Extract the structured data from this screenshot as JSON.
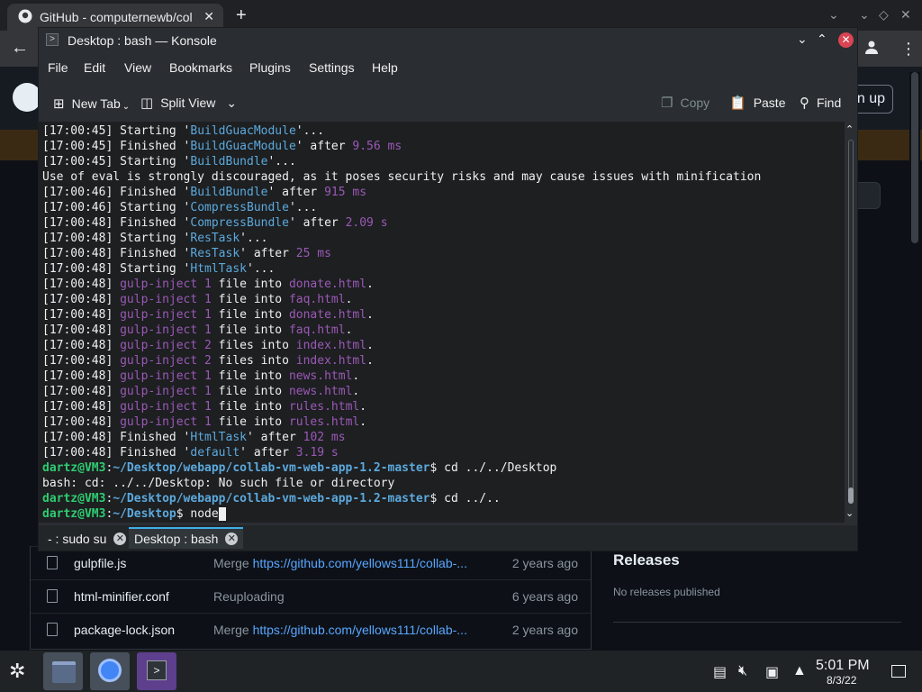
{
  "browser": {
    "tab_title": "GitHub - computernewb/collab",
    "close": "✕",
    "new_tab": "+",
    "signup_label": "n up"
  },
  "github": {
    "files": [
      {
        "name": "gulpfile.js",
        "msg_prefix": "Merge ",
        "msg_link": "https://github.com/yellows111/collab-...",
        "age": "2 years ago"
      },
      {
        "name": "html-minifier.conf",
        "msg_prefix": "Reuploading",
        "msg_link": "",
        "age": "6 years ago"
      },
      {
        "name": "package-lock.json",
        "msg_prefix": "Merge ",
        "msg_link": "https://github.com/yellows111/collab-...",
        "age": "2 years ago"
      }
    ],
    "releases_title": "Releases",
    "releases_sub": "No releases published"
  },
  "konsole": {
    "title": "Desktop : bash — Konsole",
    "menu": [
      "File",
      "Edit",
      "View",
      "Bookmarks",
      "Plugins",
      "Settings",
      "Help"
    ],
    "toolbar": {
      "new_tab": "New Tab",
      "split_view": "Split View",
      "copy": "Copy",
      "paste": "Paste",
      "find": "Find"
    },
    "lines": [
      [
        [
          "17:00:45",
          "t"
        ],
        [
          " Starting '",
          "p"
        ],
        [
          "BuildGuacModule",
          "q"
        ],
        [
          "'...",
          "p"
        ]
      ],
      [
        [
          "17:00:45",
          "t"
        ],
        [
          " Finished '",
          "p"
        ],
        [
          "BuildGuacModule",
          "q"
        ],
        [
          "' after ",
          "p"
        ],
        [
          "9.56 ms",
          "n"
        ]
      ],
      [
        [
          "17:00:45",
          "t"
        ],
        [
          " Starting '",
          "p"
        ],
        [
          "BuildBundle",
          "q"
        ],
        [
          "'...",
          "p"
        ]
      ],
      [
        [
          "Use of eval is strongly discouraged, as it poses security risks and may cause issues with minification",
          "p"
        ]
      ],
      [
        [
          "17:00:46",
          "t"
        ],
        [
          " Finished '",
          "p"
        ],
        [
          "BuildBundle",
          "q"
        ],
        [
          "' after ",
          "p"
        ],
        [
          "915 ms",
          "n"
        ]
      ],
      [
        [
          "17:00:46",
          "t"
        ],
        [
          " Starting '",
          "p"
        ],
        [
          "CompressBundle",
          "q"
        ],
        [
          "'...",
          "p"
        ]
      ],
      [
        [
          "17:00:48",
          "t"
        ],
        [
          " Finished '",
          "p"
        ],
        [
          "CompressBundle",
          "q"
        ],
        [
          "' after ",
          "p"
        ],
        [
          "2.09 s",
          "n"
        ]
      ],
      [
        [
          "17:00:48",
          "t"
        ],
        [
          " Starting '",
          "p"
        ],
        [
          "ResTask",
          "q"
        ],
        [
          "'...",
          "p"
        ]
      ],
      [
        [
          "17:00:48",
          "t"
        ],
        [
          " Finished '",
          "p"
        ],
        [
          "ResTask",
          "q"
        ],
        [
          "' after ",
          "p"
        ],
        [
          "25 ms",
          "n"
        ]
      ],
      [
        [
          "17:00:48",
          "t"
        ],
        [
          " Starting '",
          "p"
        ],
        [
          "HtmlTask",
          "q"
        ],
        [
          "'...",
          "p"
        ]
      ],
      [
        [
          "17:00:48",
          "t"
        ],
        [
          " ",
          "p"
        ],
        [
          "gulp-inject",
          "n"
        ],
        [
          " ",
          "p"
        ],
        [
          "1",
          "n"
        ],
        [
          " file into ",
          "p"
        ],
        [
          "donate.html",
          "n"
        ],
        [
          ".",
          "p"
        ]
      ],
      [
        [
          "17:00:48",
          "t"
        ],
        [
          " ",
          "p"
        ],
        [
          "gulp-inject",
          "n"
        ],
        [
          " ",
          "p"
        ],
        [
          "1",
          "n"
        ],
        [
          " file into ",
          "p"
        ],
        [
          "faq.html",
          "n"
        ],
        [
          ".",
          "p"
        ]
      ],
      [
        [
          "17:00:48",
          "t"
        ],
        [
          " ",
          "p"
        ],
        [
          "gulp-inject",
          "n"
        ],
        [
          " ",
          "p"
        ],
        [
          "1",
          "n"
        ],
        [
          " file into ",
          "p"
        ],
        [
          "donate.html",
          "n"
        ],
        [
          ".",
          "p"
        ]
      ],
      [
        [
          "17:00:48",
          "t"
        ],
        [
          " ",
          "p"
        ],
        [
          "gulp-inject",
          "n"
        ],
        [
          " ",
          "p"
        ],
        [
          "1",
          "n"
        ],
        [
          " file into ",
          "p"
        ],
        [
          "faq.html",
          "n"
        ],
        [
          ".",
          "p"
        ]
      ],
      [
        [
          "17:00:48",
          "t"
        ],
        [
          " ",
          "p"
        ],
        [
          "gulp-inject",
          "n"
        ],
        [
          " ",
          "p"
        ],
        [
          "2",
          "n"
        ],
        [
          " files into ",
          "p"
        ],
        [
          "index.html",
          "n"
        ],
        [
          ".",
          "p"
        ]
      ],
      [
        [
          "17:00:48",
          "t"
        ],
        [
          " ",
          "p"
        ],
        [
          "gulp-inject",
          "n"
        ],
        [
          " ",
          "p"
        ],
        [
          "2",
          "n"
        ],
        [
          " files into ",
          "p"
        ],
        [
          "index.html",
          "n"
        ],
        [
          ".",
          "p"
        ]
      ],
      [
        [
          "17:00:48",
          "t"
        ],
        [
          " ",
          "p"
        ],
        [
          "gulp-inject",
          "n"
        ],
        [
          " ",
          "p"
        ],
        [
          "1",
          "n"
        ],
        [
          " file into ",
          "p"
        ],
        [
          "news.html",
          "n"
        ],
        [
          ".",
          "p"
        ]
      ],
      [
        [
          "17:00:48",
          "t"
        ],
        [
          " ",
          "p"
        ],
        [
          "gulp-inject",
          "n"
        ],
        [
          " ",
          "p"
        ],
        [
          "1",
          "n"
        ],
        [
          " file into ",
          "p"
        ],
        [
          "news.html",
          "n"
        ],
        [
          ".",
          "p"
        ]
      ],
      [
        [
          "17:00:48",
          "t"
        ],
        [
          " ",
          "p"
        ],
        [
          "gulp-inject",
          "n"
        ],
        [
          " ",
          "p"
        ],
        [
          "1",
          "n"
        ],
        [
          " file into ",
          "p"
        ],
        [
          "rules.html",
          "n"
        ],
        [
          ".",
          "p"
        ]
      ],
      [
        [
          "17:00:48",
          "t"
        ],
        [
          " ",
          "p"
        ],
        [
          "gulp-inject",
          "n"
        ],
        [
          " ",
          "p"
        ],
        [
          "1",
          "n"
        ],
        [
          " file into ",
          "p"
        ],
        [
          "rules.html",
          "n"
        ],
        [
          ".",
          "p"
        ]
      ],
      [
        [
          "17:00:48",
          "t"
        ],
        [
          " Finished '",
          "p"
        ],
        [
          "HtmlTask",
          "q"
        ],
        [
          "' after ",
          "p"
        ],
        [
          "102 ms",
          "n"
        ]
      ],
      [
        [
          "17:00:48",
          "t"
        ],
        [
          " Finished '",
          "p"
        ],
        [
          "default",
          "q"
        ],
        [
          "' after ",
          "p"
        ],
        [
          "3.19 s",
          "n"
        ]
      ],
      [
        [
          "dartz@VM3",
          "u"
        ],
        [
          ":",
          "p"
        ],
        [
          "~/Desktop/webapp/collab-vm-web-app-1.2-master",
          "d"
        ],
        [
          "$ cd ../../Desktop",
          "p"
        ]
      ],
      [
        [
          "bash: cd: ../../Desktop: No such file or directory",
          "p"
        ]
      ],
      [
        [
          "dartz@VM3",
          "u"
        ],
        [
          ":",
          "p"
        ],
        [
          "~/Desktop/webapp/collab-vm-web-app-1.2-master",
          "d"
        ],
        [
          "$ cd ../..",
          "p"
        ]
      ],
      [
        [
          "dartz@VM3",
          "u"
        ],
        [
          ":",
          "p"
        ],
        [
          "~/Desktop",
          "d"
        ],
        [
          "$ node",
          "p"
        ]
      ]
    ],
    "tabs": [
      {
        "label": "- : sudo su",
        "active": false
      },
      {
        "label": "Desktop : bash",
        "active": true
      }
    ]
  },
  "taskbar": {
    "time": "5:01 PM",
    "date": "8/3/22"
  }
}
